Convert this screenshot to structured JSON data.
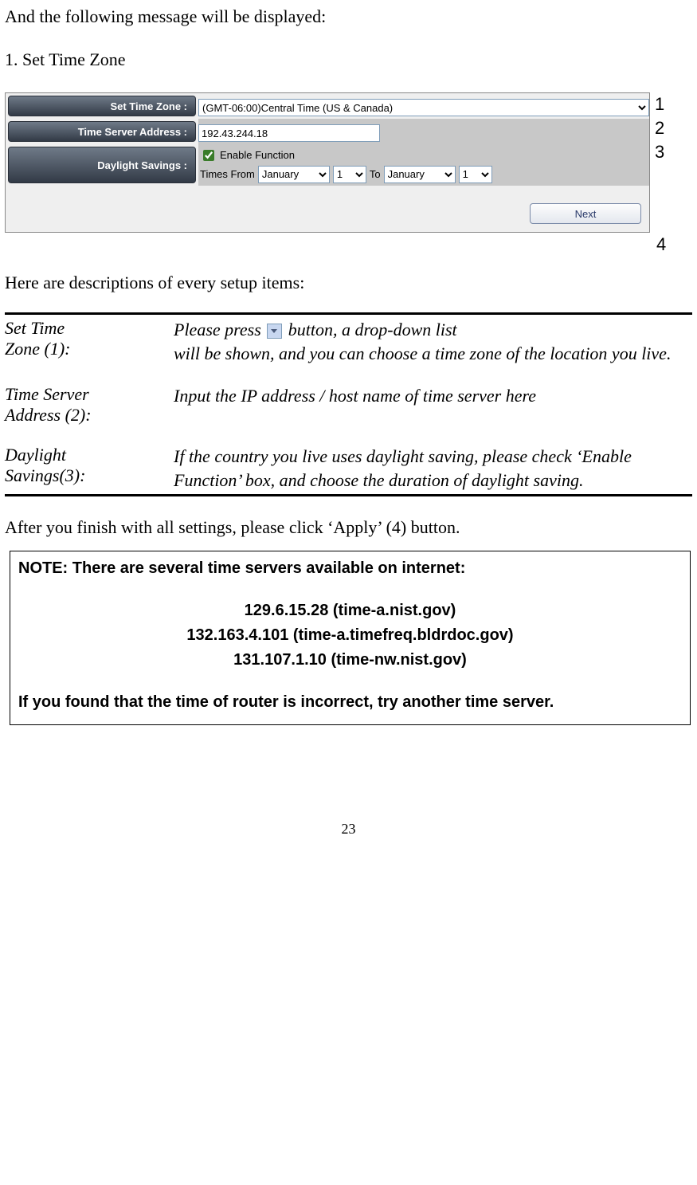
{
  "intro": "And the following message will be displayed:",
  "section_title": "1. Set Time Zone",
  "config": {
    "labels": {
      "tz": "Set Time Zone :",
      "ts": "Time Server Address :",
      "ds": "Daylight Savings :"
    },
    "tz_value": "(GMT-06:00)Central Time (US & Canada)",
    "ts_value": "192.43.244.18",
    "ds": {
      "enable_label": "Enable Function",
      "times_from": "Times From",
      "to": "To",
      "from_month": "January",
      "from_day": "1",
      "to_month": "January",
      "to_day": "1"
    },
    "next": "Next"
  },
  "callouts": {
    "c1": "1",
    "c2": "2",
    "c3": "3",
    "c4": "4"
  },
  "desc_intro": "Here are descriptions of every setup items:",
  "desc": {
    "r1_term_a": "Set Time",
    "r1_term_b": "Zone (1):",
    "r1_def_a": "Please press ",
    "r1_def_b": " button, a drop-down list",
    "r1_def_c": "will be shown, and you can choose a time zone of the location you live.",
    "r2_term_a": "Time Server",
    "r2_term_b": "Address (2):",
    "r2_def": "Input the IP address / host name of time server here",
    "r3_term_a": "Daylight",
    "r3_term_b": "Savings(3):",
    "r3_def": "If the country you live uses daylight saving, please check ‘Enable Function’ box, and choose the duration of daylight saving."
  },
  "after": "After you finish with all settings, please click ‘Apply’ (4) button.",
  "note": {
    "title": "NOTE: There are several time servers available on internet:",
    "s1": "129.6.15.28 (time-a.nist.gov)",
    "s2": "132.163.4.101 (time-a.timefreq.bldrdoc.gov)",
    "s3": "131.107.1.10 (time-nw.nist.gov)",
    "foot": "If you found that the time of router is incorrect, try another time server."
  },
  "page_number": "23"
}
